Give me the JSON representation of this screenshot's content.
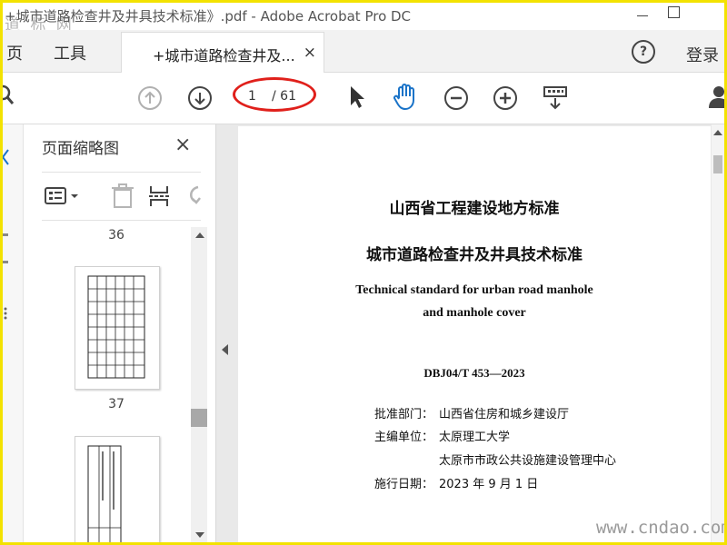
{
  "window": {
    "title": "+城市道路检查井及井具技术标准》.pdf - Adobe Acrobat Pro DC",
    "watermark": "道 标 网"
  },
  "menu": {
    "home": "页",
    "tools": "工具",
    "help": "?",
    "login": "登录"
  },
  "tab": {
    "label": "+城市道路检查井及...",
    "close": "×"
  },
  "toolbar": {
    "current_page": "1",
    "total_pages": "/ 61",
    "icons": [
      "search-icon",
      "page-up-icon",
      "page-down-icon",
      "select-arrow-icon",
      "hand-tool-icon",
      "zoom-out-icon",
      "zoom-in-icon",
      "keyboard-icon",
      "share-user-icon"
    ],
    "accent": "#1a73c8",
    "highlight": "#e0201b"
  },
  "thumbnails": {
    "title": "页面缩略图",
    "close": "×",
    "pages": [
      "36",
      "37"
    ],
    "icons": [
      "page-options-icon",
      "delete-page-icon",
      "extract-icon",
      "undo-icon"
    ]
  },
  "document": {
    "title_line1": "山西省工程建设地方标准",
    "title_line2": "城市道路检查井及井具技术标准",
    "english_line1": "Technical standard for urban road manhole",
    "english_line2": "and manhole cover",
    "code": "DBJ04/T 453—2023",
    "approve_label": "批准部门：",
    "approve_value": "山西省住房和城乡建设厅",
    "editor_label": "主编单位：",
    "editor_value1": "太原理工大学",
    "editor_value2": "太原市市政公共设施建设管理中心",
    "date_label": "施行日期：",
    "date_value": "2023 年 9 月 1 日"
  },
  "footer": {
    "watermark": "www.cndao.com"
  }
}
